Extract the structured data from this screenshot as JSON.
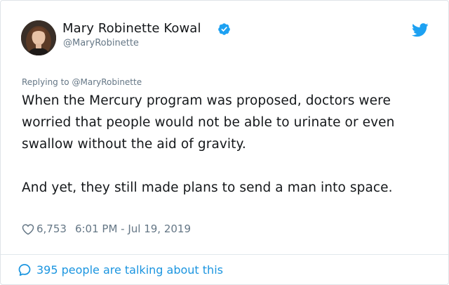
{
  "author": {
    "display_name": "Mary Robinette Kowal",
    "handle": "@MaryRobinette",
    "verified_icon": "verified-badge-icon",
    "avatar": "avatar"
  },
  "brand": {
    "icon": "twitter-bird-icon",
    "color": "#1da1f2"
  },
  "reply": {
    "prefix": "Replying to",
    "mention": "@MaryRobinette"
  },
  "tweet": {
    "paragraphs": [
      "When the Mercury program was proposed, doctors were worried that people would not be able to urinate or even swallow without the aid of gravity.",
      "And yet, they still made plans to send a man into space."
    ]
  },
  "meta": {
    "like_icon": "heart-icon",
    "likes": "6,753",
    "timestamp": "6:01 PM - Jul 19, 2019"
  },
  "footer": {
    "icon": "speech-bubble-icon",
    "talking_text": "395 people are talking about this",
    "link_color": "#1b95e0"
  }
}
